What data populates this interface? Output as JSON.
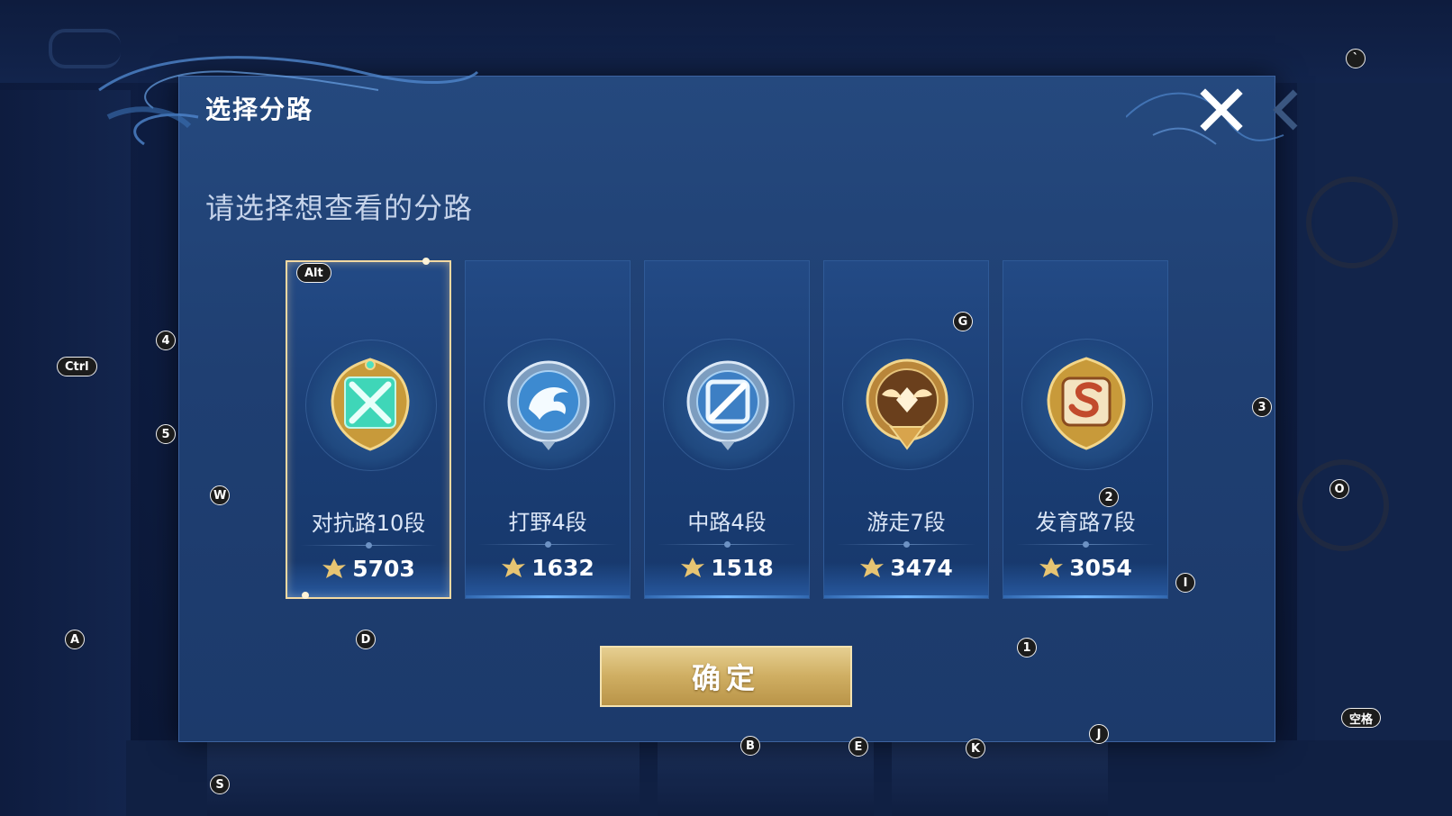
{
  "dialog": {
    "title": "选择分路",
    "prompt": "请选择想查看的分路",
    "confirm_label": "确定"
  },
  "lanes": [
    {
      "label": "对抗路10段",
      "score": "5703",
      "selected": true,
      "emblem": "clash-lane-emblem-icon"
    },
    {
      "label": "打野4段",
      "score": "1632",
      "selected": false,
      "emblem": "jungle-emblem-icon"
    },
    {
      "label": "中路4段",
      "score": "1518",
      "selected": false,
      "emblem": "mid-lane-emblem-icon"
    },
    {
      "label": "游走7段",
      "score": "3474",
      "selected": false,
      "emblem": "roam-emblem-icon"
    },
    {
      "label": "发育路7段",
      "score": "3054",
      "selected": false,
      "emblem": "farm-lane-emblem-icon"
    }
  ],
  "key_hints": {
    "alt": "Alt",
    "ctrl": "Ctrl",
    "space": "空格",
    "k4": "4",
    "k5": "5",
    "k3": "3",
    "k2": "2",
    "k1": "1",
    "w": "W",
    "g": "G",
    "o": "O",
    "i": "I",
    "a": "A",
    "d": "D",
    "b": "B",
    "e": "E",
    "k": "K",
    "j": "J",
    "s": "S",
    "backtick": "`"
  },
  "colors": {
    "dialog_bg": "#1f3f72",
    "selected_border": "#f3d9a2",
    "confirm_gold": "#cfae62",
    "score_icon_gold": "#e7c472"
  }
}
